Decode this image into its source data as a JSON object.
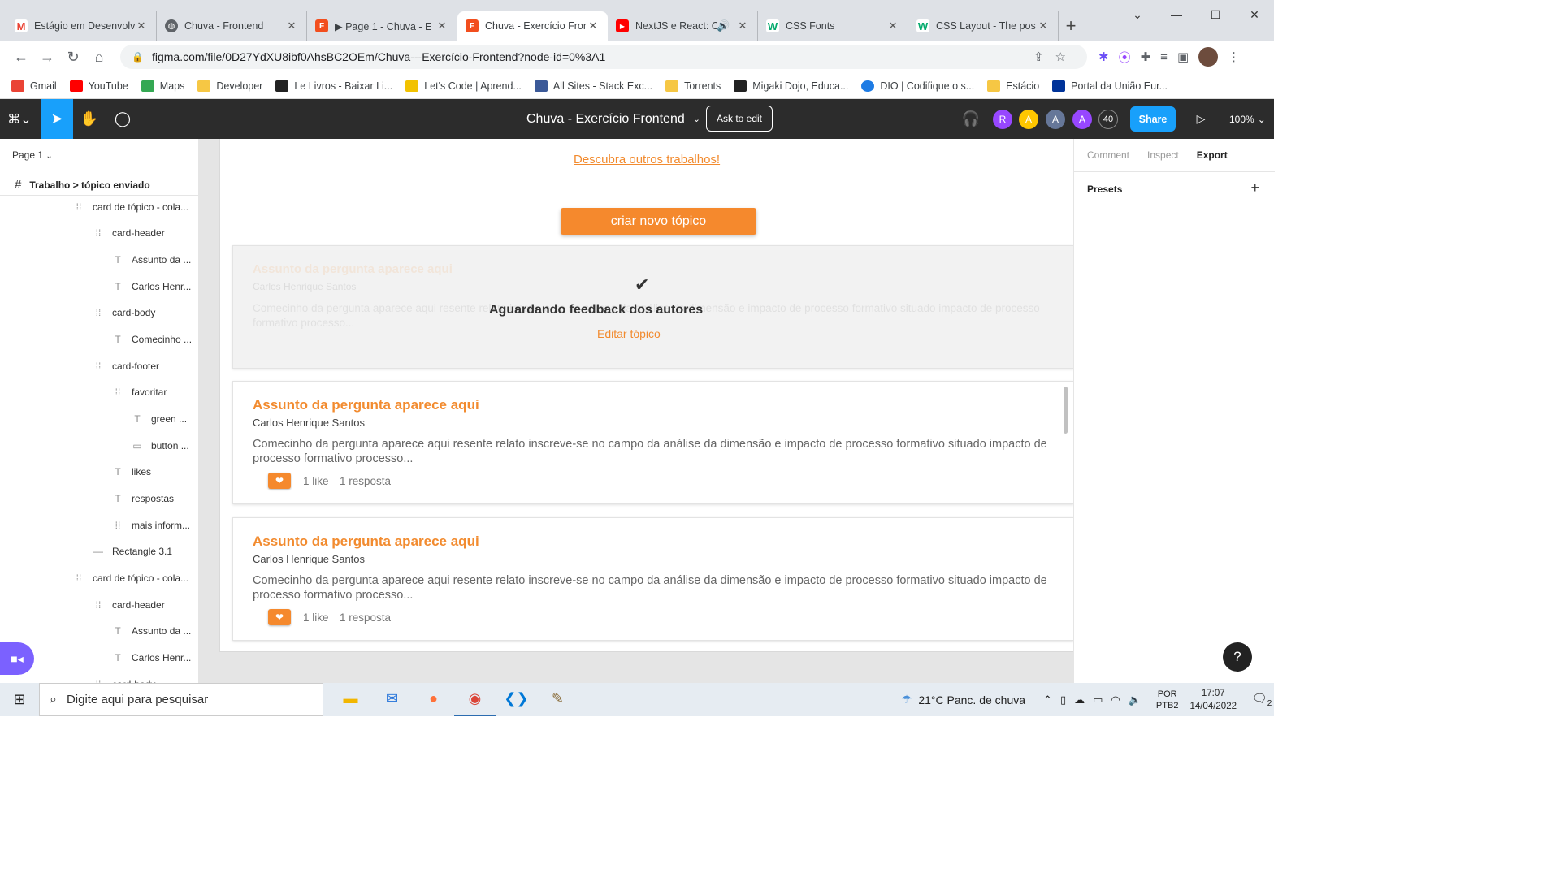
{
  "browser": {
    "tabs": [
      {
        "title": "Estágio em Desenvolv",
        "icon": "gmail-icon",
        "color": "#ea4335",
        "glyph": "M"
      },
      {
        "title": "Chuva - Frontend",
        "icon": "globe-icon",
        "color": "#5f6368",
        "glyph": "◍"
      },
      {
        "title": "▶ Page 1 - Chuva - E",
        "icon": "figma-icon",
        "color": "#f24e1e",
        "glyph": "F"
      },
      {
        "title": "Chuva - Exercício Fron",
        "icon": "figma-icon",
        "color": "#f24e1e",
        "glyph": "F",
        "active": true
      },
      {
        "title": "NextJS e React: C",
        "icon": "youtube-icon",
        "color": "#ff0000",
        "glyph": "▶"
      },
      {
        "title": "CSS Fonts",
        "icon": "w3schools-icon",
        "color": "#04aa6d",
        "glyph": "W"
      },
      {
        "title": "CSS Layout - The pos",
        "icon": "w3schools-icon",
        "color": "#04aa6d",
        "glyph": "W"
      }
    ],
    "url": "figma.com/file/0D27YdXU8ibf0AhsBC2OEm/Chuva---Exercício-Frontend?node-id=0%3A1",
    "bookmarks": [
      {
        "label": "Gmail",
        "color": "#ea4335"
      },
      {
        "label": "YouTube",
        "color": "#ff0000"
      },
      {
        "label": "Maps",
        "color": "#34a853"
      },
      {
        "label": "Developer",
        "color": "#f6c744"
      },
      {
        "label": "Le Livros - Baixar Li...",
        "color": "#222222"
      },
      {
        "label": "Let's Code | Aprend...",
        "color": "#f2c200"
      },
      {
        "label": "All Sites - Stack Exc...",
        "color": "#3b5998"
      },
      {
        "label": "Torrents",
        "color": "#f6c744"
      },
      {
        "label": "Migaki Dojo, Educa...",
        "color": "#222222"
      },
      {
        "label": "DIO | Codifique o s...",
        "color": "#1d7be4"
      },
      {
        "label": "Estácio",
        "color": "#f6c744"
      },
      {
        "label": "Portal da União Eur...",
        "color": "#003399"
      }
    ]
  },
  "figma": {
    "file_title": "Chuva - Exercício Frontend",
    "ask_to_edit": "Ask to edit",
    "users": [
      {
        "initial": "R",
        "color": "#9747ff"
      },
      {
        "initial": "A",
        "color": "#ffc700"
      },
      {
        "initial": "A",
        "color": "#667799"
      },
      {
        "initial": "A",
        "color": "#9747ff"
      }
    ],
    "user_count": "40",
    "share": "Share",
    "zoom": "100%",
    "page": "Page 1",
    "frame": "Trabalho > tópico enviado",
    "layers": [
      {
        "label": "card de tópico - cola...",
        "type": "frame"
      },
      {
        "label": "card-header",
        "type": "frame"
      },
      {
        "label": "Assunto da ...",
        "type": "text"
      },
      {
        "label": "Carlos Henr...",
        "type": "text"
      },
      {
        "label": "card-body",
        "type": "frame"
      },
      {
        "label": "Comecinho ...",
        "type": "text"
      },
      {
        "label": "card-footer",
        "type": "frame"
      },
      {
        "label": "favoritar",
        "type": "frame"
      },
      {
        "label": "green ...",
        "type": "text"
      },
      {
        "label": "button ...",
        "type": "rect"
      },
      {
        "label": "likes",
        "type": "text"
      },
      {
        "label": "respostas",
        "type": "text"
      },
      {
        "label": "mais inform...",
        "type": "frame"
      },
      {
        "label": "Rectangle 3.1",
        "type": "line"
      },
      {
        "label": "card de tópico - cola...",
        "type": "frame"
      },
      {
        "label": "card-header",
        "type": "frame"
      },
      {
        "label": "Assunto da ...",
        "type": "text"
      },
      {
        "label": "Carlos Henr...",
        "type": "text"
      },
      {
        "label": "card-body",
        "type": "frame"
      }
    ],
    "right_tabs": [
      "Comment",
      "Inspect",
      "Export"
    ],
    "presets": "Presets"
  },
  "canvas": {
    "discover_link": "Descubra outros trabalhos!",
    "create_button": "criar novo tópico",
    "pending_card": {
      "status": "Aguardando feedback dos autores",
      "edit_link": "Editar tópico",
      "title": "Assunto da pergunta aparece aqui",
      "author": "Carlos Henrique Santos",
      "body": "Comecinho da pergunta aparece aqui resente relato inscreve-se no campo da análise da dimensão e impacto de processo formativo situado impacto de processo formativo processo..."
    },
    "cards": [
      {
        "title": "Assunto da pergunta aparece aqui",
        "author": "Carlos Henrique Santos",
        "body": "Comecinho da pergunta aparece aqui resente relato inscreve-se no campo da análise da dimensão e impacto de processo formativo situado impacto de processo formativo processo...",
        "likes": "1 like",
        "replies": "1 resposta"
      },
      {
        "title": "Assunto da pergunta aparece aqui",
        "author": "Carlos Henrique Santos",
        "body": "Comecinho da pergunta aparece aqui resente relato inscreve-se no campo da análise da dimensão e impacto de processo formativo situado impacto de processo formativo processo...",
        "likes": "1 like",
        "replies": "1 resposta"
      }
    ]
  },
  "taskbar": {
    "search_placeholder": "Digite aqui para pesquisar",
    "weather": "21°C  Panc. de chuva",
    "lang1": "POR",
    "lang2": "PTB2",
    "time": "17:07",
    "date": "14/04/2022",
    "notif_count": "2"
  }
}
